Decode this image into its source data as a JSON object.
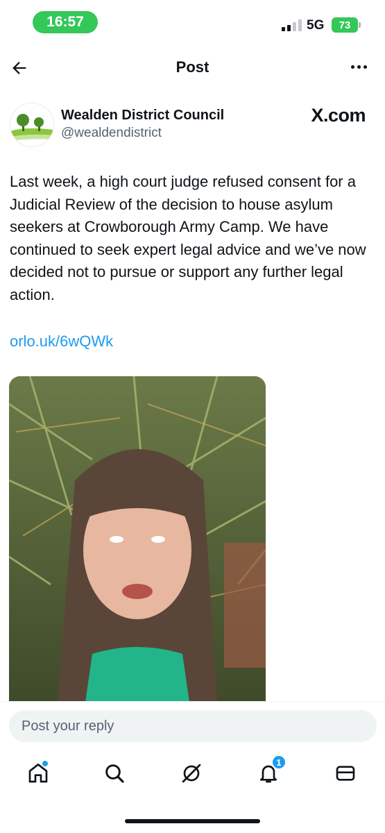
{
  "status_bar": {
    "time": "16:57",
    "network": "5G",
    "battery": "73",
    "accent_color": "#34c759"
  },
  "header": {
    "title": "Post",
    "back_icon": "arrow-left-icon",
    "more_icon": "more-horizontal-icon"
  },
  "post": {
    "author_name": "Wealden District Council",
    "author_handle": "@wealdendistrict",
    "source": "X.com",
    "text": "Last week, a high court judge refused consent for a Judicial Review of the decision to house asylum seekers at Crowborough Army Camp. We have continued to seek expert legal advice and we’ve now decided not to pursue or support any further legal action.",
    "link": "orlo.uk/6wQWk",
    "link_color": "#1d9bf0"
  },
  "reply": {
    "placeholder": "Post your reply"
  },
  "tabbar": {
    "items": [
      {
        "name": "home",
        "icon": "home-icon",
        "has_dot": true
      },
      {
        "name": "search",
        "icon": "search-icon"
      },
      {
        "name": "grok",
        "icon": "grok-icon"
      },
      {
        "name": "notifications",
        "icon": "bell-icon",
        "badge": "1"
      },
      {
        "name": "messages",
        "icon": "mail-icon"
      }
    ]
  }
}
